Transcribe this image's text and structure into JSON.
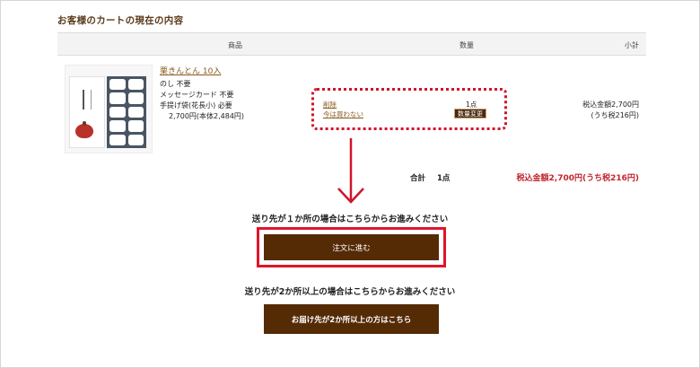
{
  "section": {
    "title": "お客様のカートの現在の内容"
  },
  "table": {
    "headers": {
      "product": "商品",
      "quantity": "数量",
      "subtotal": "小計"
    }
  },
  "item": {
    "name": "栗きんとん 10入",
    "options": [
      "のし 不要",
      "メッセージカード 不要",
      "手提げ袋(花長小) 必要"
    ],
    "unit_price": "2,700円(本体2,484円)",
    "delete_label": "削除",
    "later_label": "今は買わない",
    "quantity": "1点",
    "change_qty_label": "数量変更",
    "subtotal_line1": "税込金額2,700円",
    "subtotal_line2": "(うち税216円)"
  },
  "total": {
    "label": "合計",
    "count": "1点",
    "amount": "税込金額2,700円(うち税216円)"
  },
  "checkout": {
    "single_guide": "送り先が１か所の場合はこちらからお進みください",
    "single_button": "注文に進む",
    "multi_guide": "送り先が2か所以上の場合はこちらからお進みください",
    "multi_button": "お届け先が2か所以上の方はこちら"
  },
  "colors": {
    "brand_brown": "#552b06",
    "highlight_red": "#e0142c",
    "price_red": "#c0262c",
    "link_brown": "#8a5a20"
  },
  "icons": {
    "guide_arrow": "arrow-down-icon"
  }
}
